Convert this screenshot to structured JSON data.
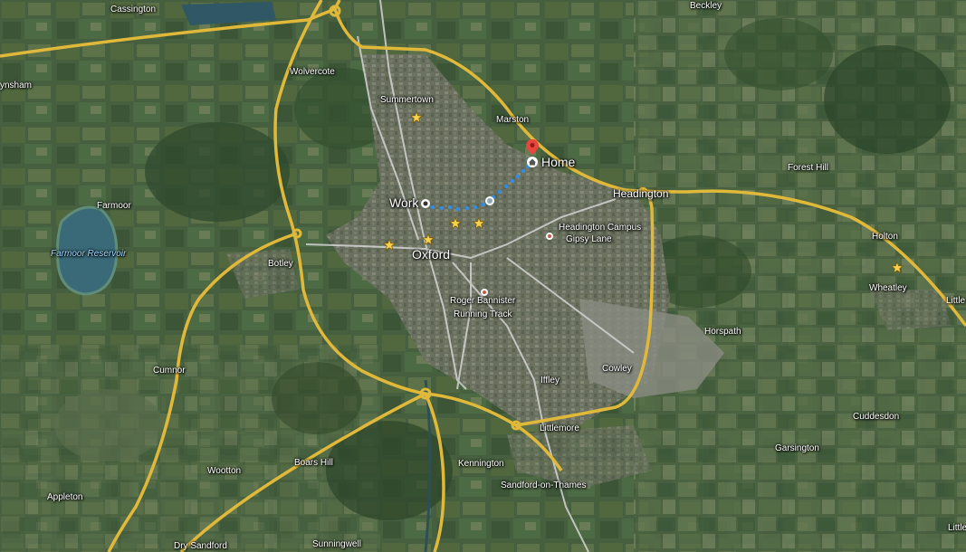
{
  "map": {
    "place_labels": {
      "cassington": "Cassington",
      "beckley": "Beckley",
      "eynsham": "ynsham",
      "wolvercote": "Wolvercote",
      "summertown": "Summertown",
      "marston": "Marston",
      "forest_hill": "Forest Hill",
      "headington": "Headington",
      "farmoor": "Farmoor",
      "holton": "Holton",
      "botley": "Botley",
      "oxford": "Oxford",
      "wheatley": "Wheatley",
      "little_east": "Little",
      "horspath": "Horspath",
      "cumnor": "Cumnor",
      "iffley": "Iffley",
      "cowley": "Cowley",
      "littlemore": "Littlemore",
      "cuddesdon": "Cuddesdon",
      "garsington": "Garsington",
      "wootton": "Wootton",
      "boars_hill": "Boars Hill",
      "kennington": "Kennington",
      "sandford": "Sandford-on-Thames",
      "appleton": "Appleton",
      "dry_sandford": "Dry Sandford",
      "sunningwell": "Sunningwell",
      "little_se": "Little"
    },
    "water_labels": {
      "farmoor_reservoir": "Farmoor Reservoir"
    },
    "poi": {
      "headington_campus_1": "Headington Campus",
      "headington_campus_2": "Gipsy Lane",
      "running_track_1": "Roger Bannister",
      "running_track_2": "Running Track"
    },
    "pins": {
      "work": "Work",
      "home": "Home"
    },
    "colors": {
      "road_major": "#e0b83a",
      "road_minor": "#d4d4d4",
      "route": "#2f8fe8",
      "home_pin": "#e8453c",
      "star": "#f7d34a"
    }
  }
}
